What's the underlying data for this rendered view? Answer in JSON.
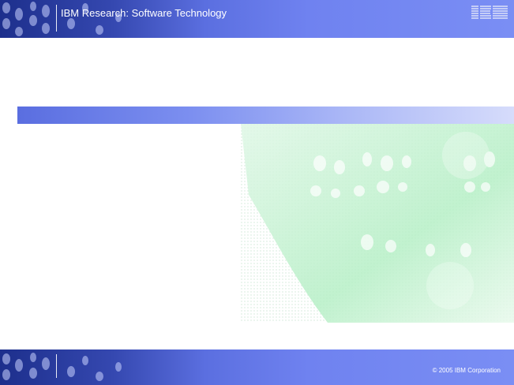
{
  "header": {
    "title": "IBM Research: Software Technology",
    "logo_text": "IBM"
  },
  "footer": {
    "copyright": "© 2005 IBM Corporation"
  },
  "colors": {
    "banner_blue": "#5b6fe0",
    "title_bar_blue": "#6f82f0",
    "art_green": "#b8f0c8"
  },
  "icons": {
    "logo": "ibm-logo-icon",
    "decoration": "binary-pattern-icon"
  }
}
